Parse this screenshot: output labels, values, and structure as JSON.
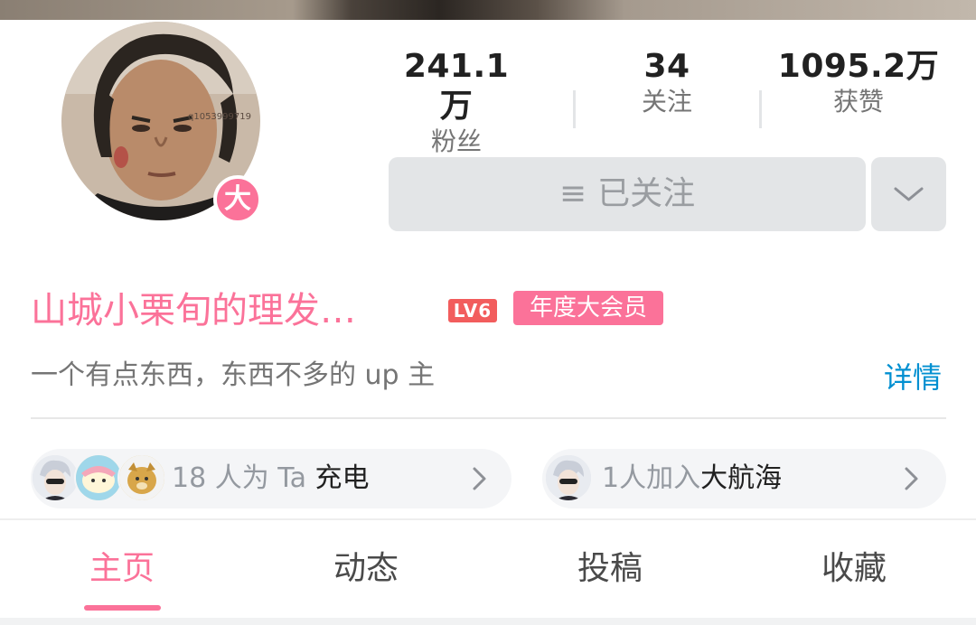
{
  "stats": {
    "fans": {
      "value": "241.1万",
      "label": "粉丝"
    },
    "following": {
      "value": "34",
      "label": "关注"
    },
    "likes": {
      "value": "1095.2万",
      "label": "获赞"
    }
  },
  "avatar_watermark": "q1053999719",
  "vip_badge_char": "大",
  "follow_button": {
    "icon": "≡",
    "label": "已关注"
  },
  "profile": {
    "name": "山城小栗旬的理发…",
    "level": "LV6",
    "vip_tag": "年度大会员",
    "bio": "一个有点东西，东西不多的 up 主",
    "detail_link": "详情"
  },
  "charge": {
    "count_text": "18 人为 Ta ",
    "action": "充电"
  },
  "guard": {
    "count_text": "1人加入",
    "action": "大航海"
  },
  "tabs": [
    {
      "label": "主页",
      "active": true
    },
    {
      "label": "动态",
      "active": false
    },
    {
      "label": "投稿",
      "active": false
    },
    {
      "label": "收藏",
      "active": false
    }
  ],
  "colors": {
    "accent": "#fb7299",
    "link": "#0290d1",
    "level": "#f25d5d",
    "button_bg": "#e3e5e7"
  },
  "icons": [
    "chevron-down-icon",
    "chevron-right-icon",
    "menu-lines-icon"
  ]
}
